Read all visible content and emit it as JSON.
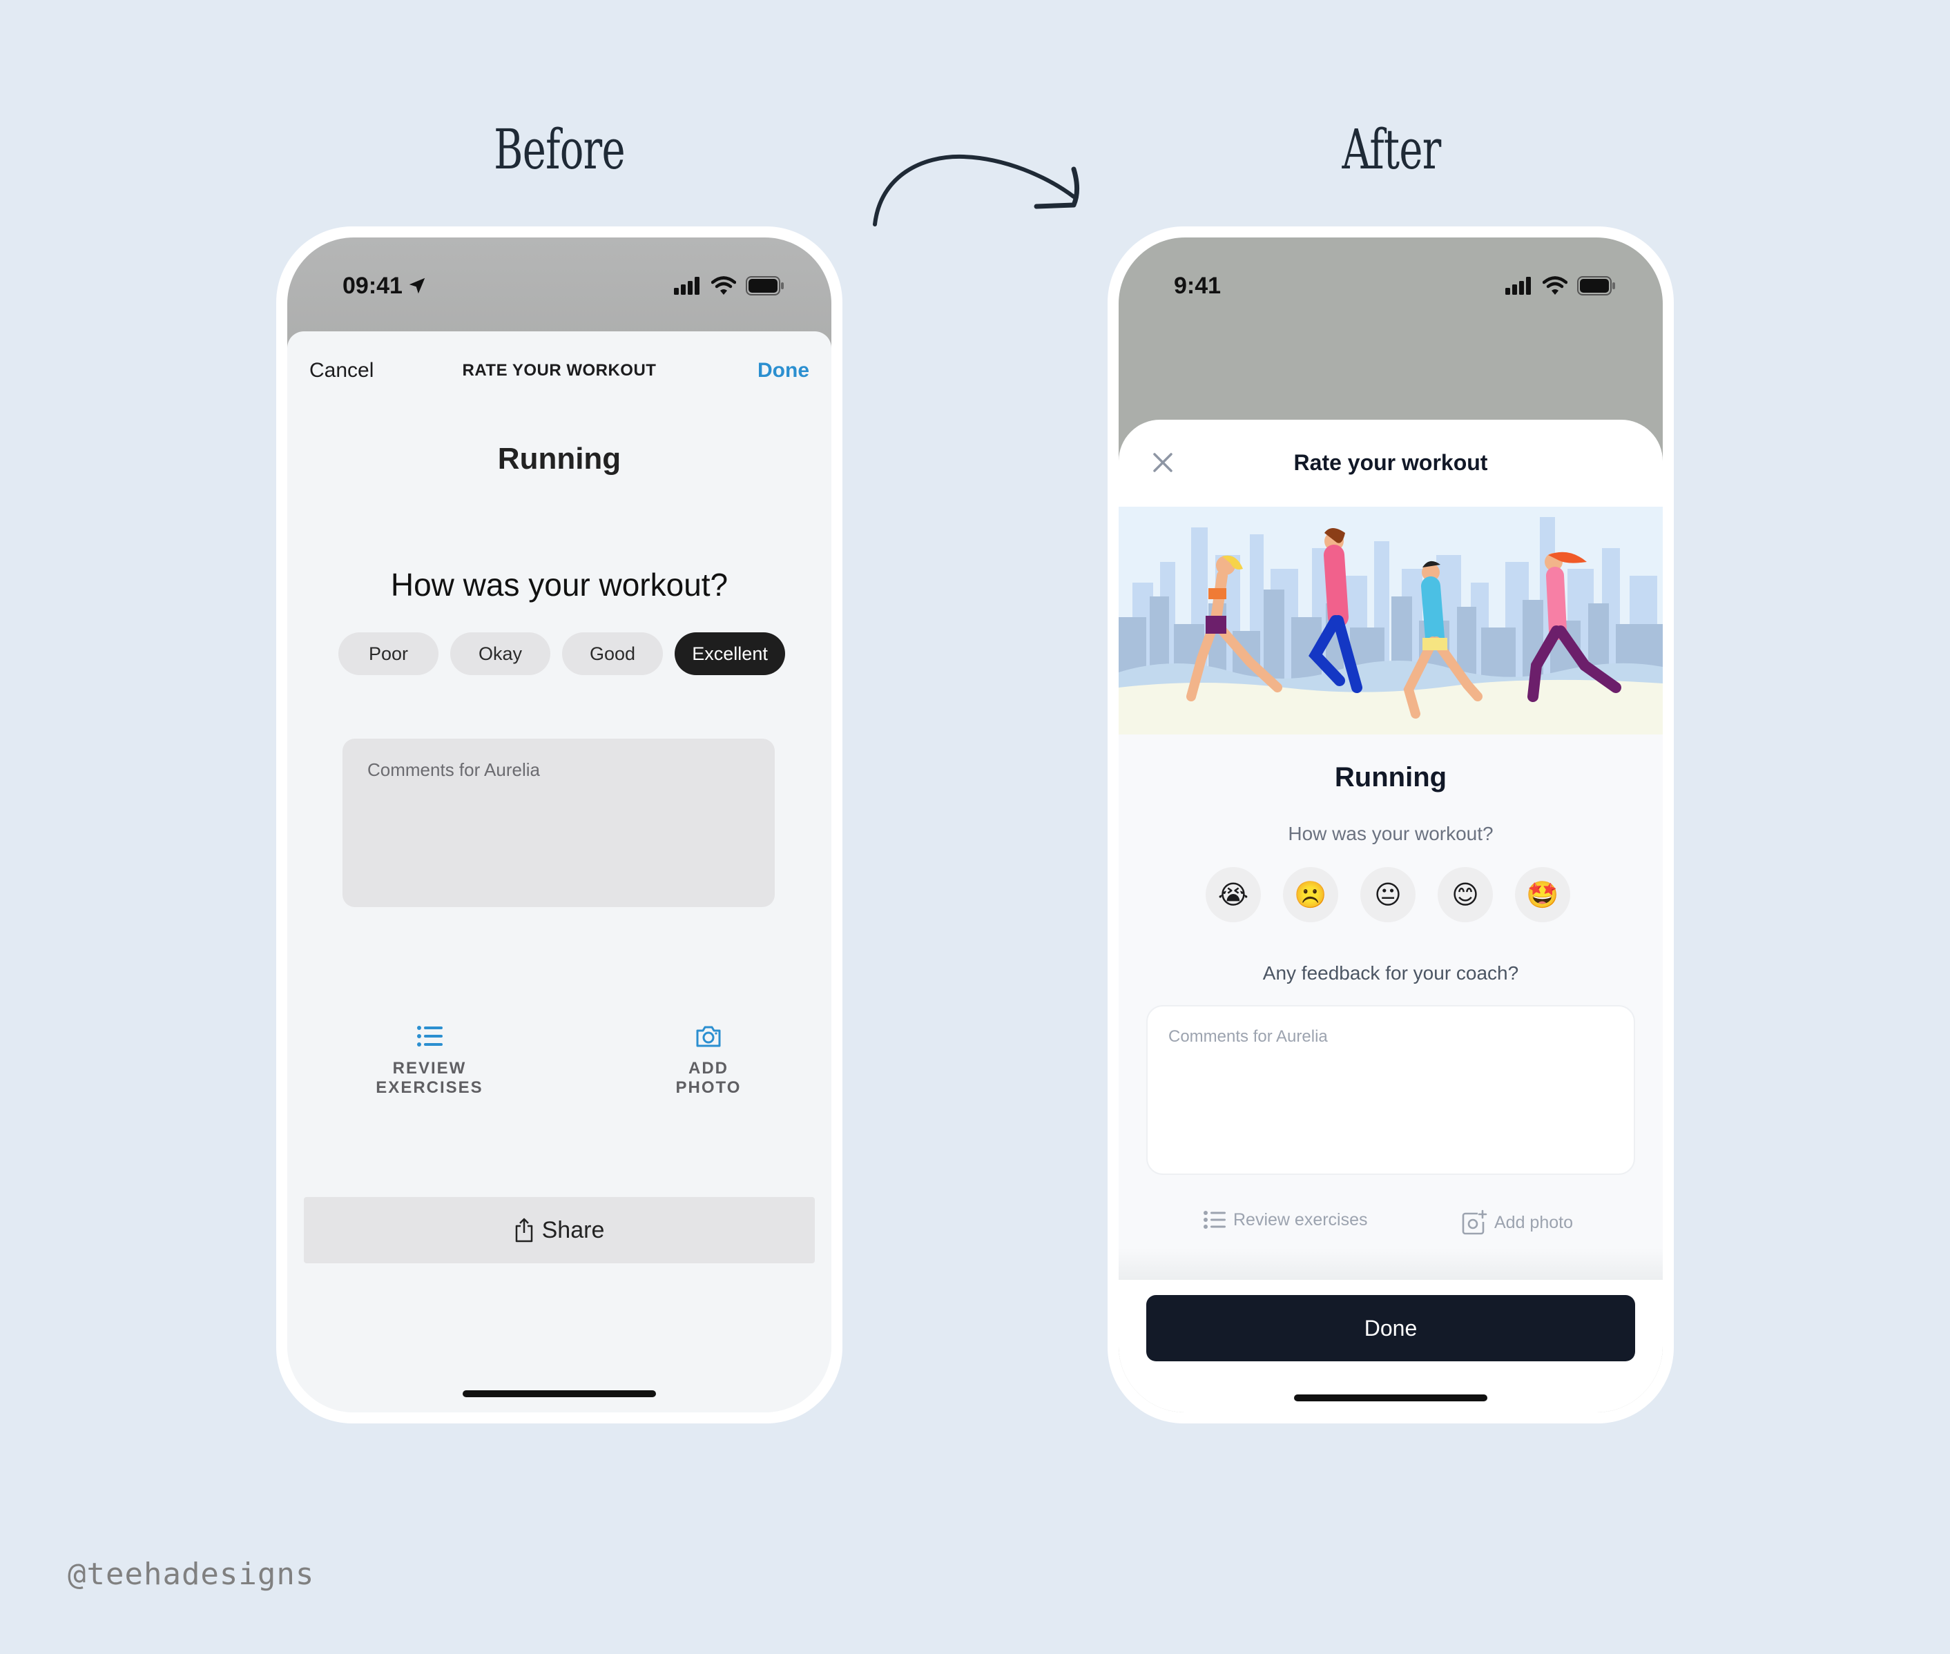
{
  "labels": {
    "before": "Before",
    "after": "After",
    "watermark": "@teehadesigns"
  },
  "before": {
    "status": {
      "time": "09:41",
      "location_icon": "location-arrow-icon"
    },
    "nav": {
      "cancel": "Cancel",
      "title": "RATE YOUR WORKOUT",
      "done": "Done"
    },
    "activity": "Running",
    "question": "How was your workout?",
    "ratings": [
      {
        "label": "Poor",
        "selected": false
      },
      {
        "label": "Okay",
        "selected": false
      },
      {
        "label": "Good",
        "selected": false
      },
      {
        "label": "Excellent",
        "selected": true
      }
    ],
    "comments_placeholder": "Comments for Aurelia",
    "actions": {
      "review_line1": "REVIEW",
      "review_line2": "EXERCISES",
      "photo_line1": "ADD",
      "photo_line2": "PHOTO"
    },
    "share_label": "Share",
    "accent_color": "#2b8fd0"
  },
  "after": {
    "status": {
      "time": "9:41"
    },
    "nav": {
      "title": "Rate your workout"
    },
    "hero_alt": "Illustration of four people running in front of a city skyline",
    "activity": "Running",
    "question": "How was your workout?",
    "emoji_ratings": [
      {
        "emoji": "😭",
        "meaning": "awful"
      },
      {
        "emoji": "☹️",
        "meaning": "bad"
      },
      {
        "emoji": "😐",
        "meaning": "neutral"
      },
      {
        "emoji": "😊",
        "meaning": "good"
      },
      {
        "emoji": "🤩",
        "meaning": "amazing"
      }
    ],
    "feedback_question": "Any feedback for your coach?",
    "comments_placeholder": "Comments for Aurelia",
    "review_link": "Review exercises",
    "photo_link": "Add photo",
    "done_label": "Done",
    "primary_color": "#131a28"
  }
}
